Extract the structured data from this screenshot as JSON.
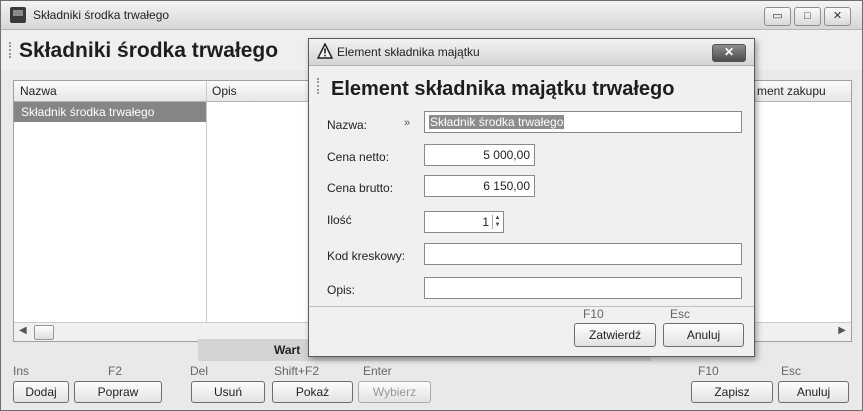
{
  "window": {
    "title": "Składniki środka trwałego",
    "header_title": "Składniki środka trwałego",
    "controls": {
      "minimize": "▭",
      "maximize": "□",
      "close": "✕"
    }
  },
  "grid": {
    "columns": [
      "Nazwa",
      "Opis",
      "ment zakupu"
    ],
    "rows": [
      {
        "name": "Składnik środka trwałego"
      }
    ],
    "footer_label": "Wart"
  },
  "toolbar": {
    "buttons": [
      {
        "key": "Ins",
        "label": "Dodaj"
      },
      {
        "key": "F2",
        "label": "Popraw"
      },
      {
        "key": "Del",
        "label": "Usuń"
      },
      {
        "key": "Shift+F2",
        "label": "Pokaż"
      },
      {
        "key": "Enter",
        "label": "Wybierz"
      }
    ],
    "save": {
      "key": "F10",
      "label": "Zapisz"
    },
    "cancel": {
      "key": "Esc",
      "label": "Anuluj"
    }
  },
  "dialog": {
    "title": "Element składnika majątku",
    "header_title": "Element składnika majątku trwałego",
    "close": "✕",
    "marker": "»",
    "fields": {
      "nazwa": {
        "label": "Nazwa:",
        "value": "Składnik środka trwałego"
      },
      "cena_netto": {
        "label": "Cena netto:",
        "value": "5 000,00"
      },
      "cena_brutto": {
        "label": "Cena brutto:",
        "value": "6 150,00"
      },
      "ilosc": {
        "label": "Ilość",
        "value": "1"
      },
      "kod": {
        "label": "Kod kreskowy:",
        "value": ""
      },
      "opis": {
        "label": "Opis:",
        "value": ""
      }
    },
    "confirm": {
      "key": "F10",
      "label": "Zatwierdź"
    },
    "cancel": {
      "key": "Esc",
      "label": "Anuluj"
    }
  }
}
